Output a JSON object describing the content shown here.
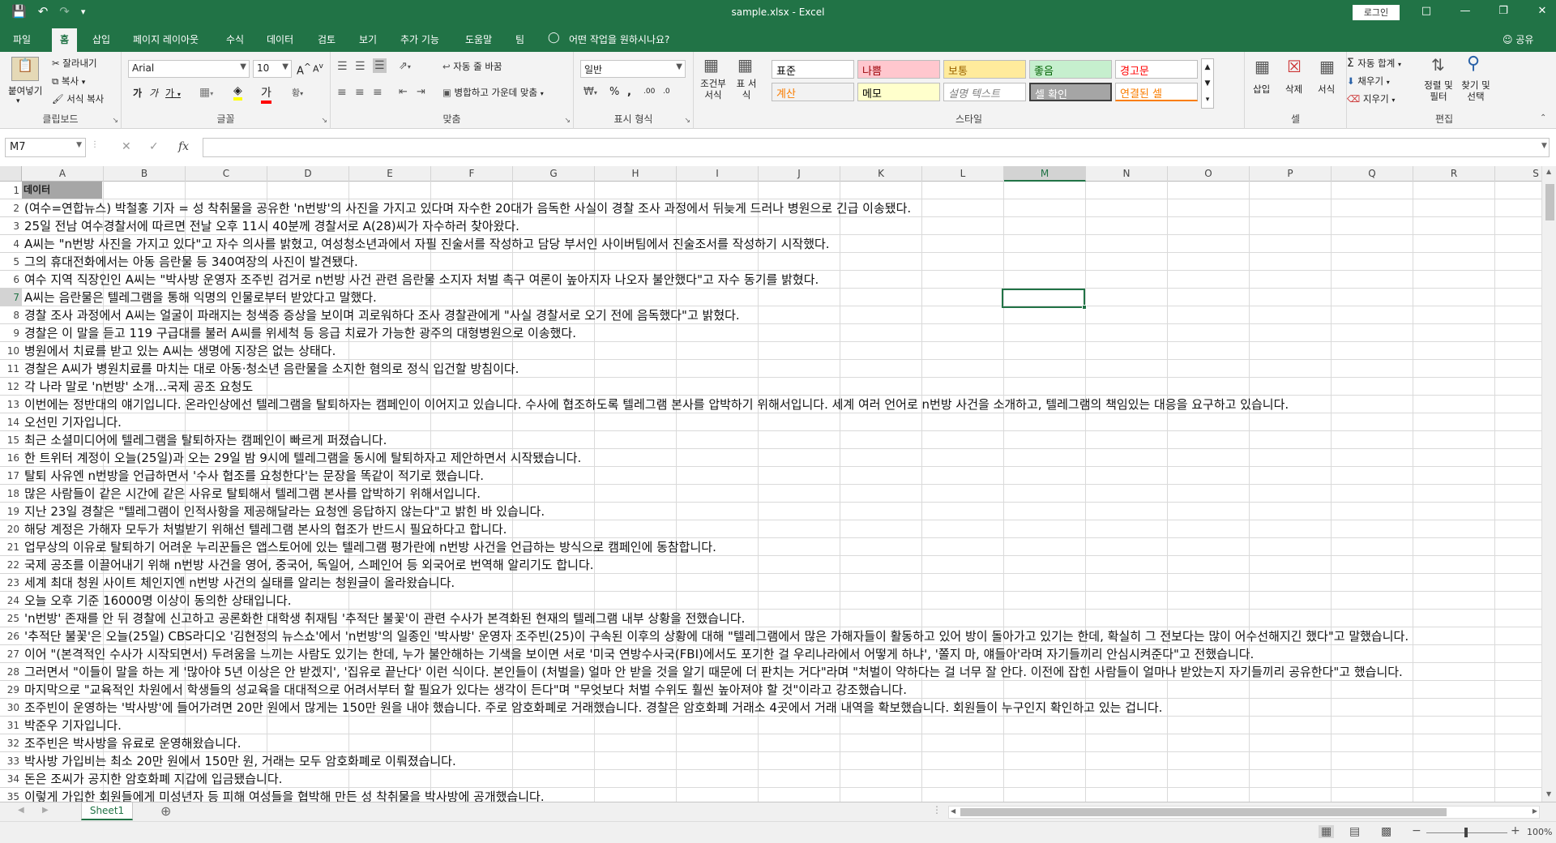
{
  "titlebar": {
    "document_title": "sample.xlsx  -  Excel",
    "login_label": "로그인"
  },
  "tabs": [
    "파일",
    "홈",
    "삽입",
    "페이지 레이아웃",
    "수식",
    "데이터",
    "검토",
    "보기",
    "추가 기능",
    "도움말",
    "팀"
  ],
  "active_tab": "홈",
  "tellme": "어떤 작업을 원하시나요?",
  "share_label": "공유",
  "ribbon": {
    "clipboard": {
      "label": "클립보드",
      "paste": "붙여넣기",
      "cut": "잘라내기",
      "copy": "복사",
      "format_painter": "서식 복사"
    },
    "font": {
      "label": "글꼴",
      "font_name": "Arial",
      "font_size": "10"
    },
    "alignment": {
      "label": "맞춤",
      "wrap_text": "자동 줄 바꿈",
      "merge_center": "병합하고 가운데 맞춤"
    },
    "number": {
      "label": "표시 형식",
      "format": "일반"
    },
    "styles": {
      "label": "스타일",
      "conditional": "조건부 서식",
      "table": "표 서식",
      "cells": [
        {
          "text": "표준",
          "bg": "#ffffff",
          "color": "#000000"
        },
        {
          "text": "나쁨",
          "bg": "#ffc7ce",
          "color": "#9c0006"
        },
        {
          "text": "보통",
          "bg": "#ffeb9c",
          "color": "#9c6500"
        },
        {
          "text": "좋음",
          "bg": "#c6efce",
          "color": "#006100"
        },
        {
          "text": "경고문",
          "bg": "#ffffff",
          "color": "#ff0000"
        },
        {
          "text": "계산",
          "bg": "#f2f2f2",
          "color": "#fa7d00"
        },
        {
          "text": "메모",
          "bg": "#ffffcc",
          "color": "#000000"
        },
        {
          "text": "설명 텍스트",
          "bg": "#ffffff",
          "color": "#7f7f7f"
        },
        {
          "text": "셀 확인",
          "bg": "#a5a5a5",
          "color": "#ffffff"
        },
        {
          "text": "연결된 셀",
          "bg": "#ffffff",
          "color": "#fa7d00"
        }
      ]
    },
    "cells": {
      "label": "셀",
      "insert": "삽입",
      "delete": "삭제",
      "format": "서식"
    },
    "editing": {
      "label": "편집",
      "autosum": "자동 합계",
      "fill": "채우기",
      "clear": "지우기",
      "sort_filter": "정렬 및 필터",
      "find_select": "찾기 및 선택"
    }
  },
  "formula_bar": {
    "name_box": "M7",
    "formula": ""
  },
  "columns": [
    "A",
    "B",
    "C",
    "D",
    "E",
    "F",
    "G",
    "H",
    "I",
    "J",
    "K",
    "L",
    "M",
    "N",
    "O",
    "P",
    "Q",
    "R",
    "S"
  ],
  "selected_column": "M",
  "selected_row": "7",
  "rows": [
    {
      "n": "1",
      "text": "데이터"
    },
    {
      "n": "2",
      "text": "(여수=연합뉴스) 박철홍 기자 = 성 착취물을 공유한 'n번방'의 사진을 가지고 있다며 자수한 20대가 음독한 사실이 경찰 조사 과정에서 뒤늦게 드러나 병원으로 긴급 이송됐다."
    },
    {
      "n": "3",
      "text": "25일 전남 여수경찰서에 따르면 전날 오후 11시 40분께 경찰서로 A(28)씨가 자수하러 찾아왔다."
    },
    {
      "n": "4",
      "text": "A씨는 \"n번방 사진을 가지고 있다\"고 자수 의사를 밝혔고, 여성청소년과에서 자필 진술서를 작성하고 담당 부서인 사이버팀에서 진술조서를 작성하기 시작했다."
    },
    {
      "n": "5",
      "text": "그의 휴대전화에서는 아동 음란물 등 340여장의 사진이 발견됐다."
    },
    {
      "n": "6",
      "text": "여수 지역 직장인인 A씨는 \"박사방 운영자 조주빈 검거로 n번방 사건 관련 음란물 소지자 처벌 촉구 여론이 높아지자 나오자 불안했다\"고 자수 동기를 밝혔다."
    },
    {
      "n": "7",
      "text": "A씨는 음란물은 텔레그램을 통해 익명의 인물로부터 받았다고 말했다."
    },
    {
      "n": "8",
      "text": "경찰 조사 과정에서 A씨는 얼굴이 파래지는 청색증 증상을 보이며 괴로워하다 조사 경찰관에게 \"사실 경찰서로 오기 전에 음독했다\"고 밝혔다."
    },
    {
      "n": "9",
      "text": "경찰은 이 말을 듣고 119 구급대를 불러 A씨를 위세척 등 응급 치료가 가능한 광주의 대형병원으로 이송했다."
    },
    {
      "n": "10",
      "text": "병원에서 치료를 받고 있는 A씨는 생명에 지장은 없는 상태다."
    },
    {
      "n": "11",
      "text": "경찰은 A씨가 병원치료를 마치는 대로 아동·청소년 음란물을 소지한 혐의로 정식 입건할 방침이다."
    },
    {
      "n": "12",
      "text": "각 나라 말로 'n번방' 소개…국제 공조 요청도"
    },
    {
      "n": "13",
      "text": "이번에는 정반대의 얘기입니다. 온라인상에선 텔레그램을 탈퇴하자는 캠페인이 이어지고 있습니다. 수사에 협조하도록 텔레그램 본사를 압박하기 위해서입니다. 세계 여러 언어로 n번방 사건을 소개하고, 텔레그램의 책임있는 대응을 요구하고 있습니다."
    },
    {
      "n": "14",
      "text": "오선민 기자입니다."
    },
    {
      "n": "15",
      "text": "최근 소셜미디어에 텔레그램을 탈퇴하자는 캠페인이 빠르게 퍼졌습니다."
    },
    {
      "n": "16",
      "text": "한 트위터 계정이 오늘(25일)과 오는 29일 밤 9시에 텔레그램을 동시에 탈퇴하자고 제안하면서 시작됐습니다."
    },
    {
      "n": "17",
      "text": "탈퇴 사유엔 n번방을 언급하면서 '수사 협조를 요청한다'는 문장을 똑같이 적기로 했습니다."
    },
    {
      "n": "18",
      "text": "많은 사람들이 같은 시간에 같은 사유로 탈퇴해서 텔레그램 본사를 압박하기 위해서입니다."
    },
    {
      "n": "19",
      "text": "지난 23일 경찰은 \"텔레그램이 인적사항을 제공해달라는 요청엔 응답하지 않는다\"고 밝힌 바 있습니다."
    },
    {
      "n": "20",
      "text": "해당 계정은 가해자 모두가 처벌받기 위해선 텔레그램 본사의 협조가 반드시 필요하다고 합니다."
    },
    {
      "n": "21",
      "text": "업무상의 이유로 탈퇴하기 어려운 누리꾼들은 앱스토어에 있는 텔레그램 평가란에 n번방 사건을 언급하는 방식으로 캠페인에 동참합니다."
    },
    {
      "n": "22",
      "text": "국제 공조를 이끌어내기 위해 n번방 사건을 영어, 중국어, 독일어, 스페인어 등 외국어로 번역해 알리기도 합니다."
    },
    {
      "n": "23",
      "text": "세계 최대 청원 사이트 체인지엔 n번방 사건의 실태를 알리는 청원글이 올라왔습니다."
    },
    {
      "n": "24",
      "text": "오늘 오후 기준 16000명 이상이 동의한 상태입니다."
    },
    {
      "n": "25",
      "text": "'n번방' 존재를 안 뒤 경찰에 신고하고 공론화한 대학생 취재팀 '추적단 불꽃'이 관련 수사가 본격화된 현재의 텔레그램 내부 상황을 전했습니다."
    },
    {
      "n": "26",
      "text": "'추적단 불꽃'은 오늘(25일) CBS라디오 '김현정의 뉴스쇼'에서 'n번방'의 일종인 '박사방' 운영자 조주빈(25)이 구속된 이후의 상황에 대해 \"텔레그램에서 많은 가해자들이 활동하고 있어 방이 돌아가고 있기는 한데, 확실히 그 전보다는 많이 어수선해지긴 했다\"고 말했습니다."
    },
    {
      "n": "27",
      "text": "이어 \"(본격적인 수사가 시작되면서) 두려움을 느끼는 사람도 있기는 한데, 누가 불안해하는 기색을 보이면 서로 '미국 연방수사국(FBI)에서도 포기한 걸 우리나라에서 어떻게 하냐', '쫄지 마, 얘들아'라며 자기들끼리 안심시켜준다\"고 전했습니다."
    },
    {
      "n": "28",
      "text": "그러면서 \"이들이 말을 하는 게 '많아야 5년 이상은 안 받겠지', '집유로 끝난다' 이런 식이다. 본인들이 (처벌을) 얼마 안 받을 것을 알기 때문에 더 판치는 거다\"라며 \"처벌이 약하다는 걸 너무 잘 안다. 이전에 잡힌 사람들이 얼마나 받았는지 자기들끼리 공유한다\"고 했습니다."
    },
    {
      "n": "29",
      "text": "마지막으로 \"교육적인 차원에서 학생들의 성교육을 대대적으로 어려서부터 할 필요가 있다는 생각이 든다\"며 \"무엇보다 처벌 수위도 훨씬 높아져야 할 것\"이라고 강조했습니다."
    },
    {
      "n": "30",
      "text": "조주빈이 운영하는 '박사방'에 들어가려면 20만 원에서 많게는 150만 원을 내야 했습니다. 주로 암호화폐로 거래했습니다. 경찰은 암호화폐 거래소 4곳에서 거래 내역을 확보했습니다. 회원들이 누구인지 확인하고 있는 겁니다."
    },
    {
      "n": "31",
      "text": "박준우 기자입니다."
    },
    {
      "n": "32",
      "text": "조주빈은 박사방을 유료로 운영해왔습니다."
    },
    {
      "n": "33",
      "text": "박사방 가입비는 최소 20만 원에서 150만 원, 거래는 모두 암호화폐로 이뤄졌습니다."
    },
    {
      "n": "34",
      "text": "돈은 조씨가 공지한 암호화폐 지갑에 입금됐습니다."
    },
    {
      "n": "35",
      "text": "이렇게 가입한 회원들에게 미성년자 등 피해 여성들을 협박해 만든 성 착취물을 박사방에 공개했습니다."
    }
  ],
  "sheets": [
    "Sheet1"
  ],
  "zoom": "100%"
}
